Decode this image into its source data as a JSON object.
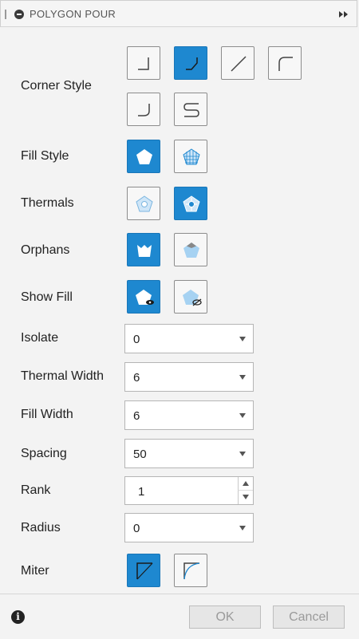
{
  "window": {
    "title": "POLYGON POUR"
  },
  "colors": {
    "accent": "#1e88d0",
    "icon_light": "#a6d2f2"
  },
  "rows": {
    "corner_style": {
      "label": "Corner Style"
    },
    "fill_style": {
      "label": "Fill Style"
    },
    "thermals": {
      "label": "Thermals"
    },
    "orphans": {
      "label": "Orphans"
    },
    "show_fill": {
      "label": "Show Fill"
    },
    "isolate": {
      "label": "Isolate",
      "value": "0"
    },
    "thermal_width": {
      "label": "Thermal Width",
      "value": "6"
    },
    "fill_width": {
      "label": "Fill Width",
      "value": "6"
    },
    "spacing": {
      "label": "Spacing",
      "value": "50"
    },
    "rank": {
      "label": "Rank",
      "value": "1"
    },
    "radius": {
      "label": "Radius",
      "value": "0"
    },
    "miter": {
      "label": "Miter"
    }
  },
  "footer": {
    "ok_label": "OK",
    "cancel_label": "Cancel",
    "info_glyph": "i"
  }
}
